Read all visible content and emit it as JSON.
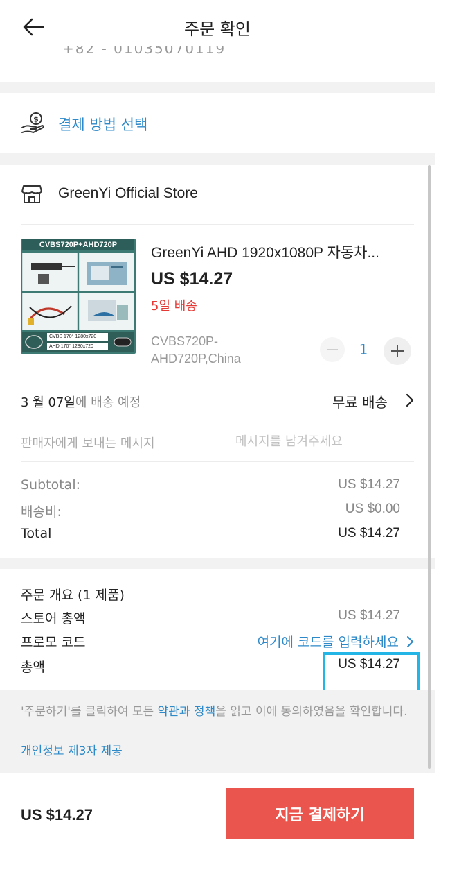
{
  "header": {
    "title": "주문 확인",
    "back_icon": "arrow-left-icon",
    "address_partial": "+82 - 01035070119"
  },
  "payment": {
    "label": "결제 방법 선택",
    "icon": "hand-coin-icon"
  },
  "store": {
    "name": "GreenYi Official Store",
    "icon": "storefront-icon"
  },
  "product": {
    "image_banner": "CVBS720P+AHD720P",
    "image_strip": [
      "CVBS 170° 1280x720",
      "AHD 170° 1280x720"
    ],
    "title": "GreenYi AHD 1920x1080P 자동차...",
    "price": "US $14.27",
    "shipping": "5일 배송",
    "variant": "CVBS720P-AHD720P,China",
    "quantity": "1"
  },
  "delivery": {
    "date_strong": "3 월 07일",
    "date_rest": "에 배송 예정",
    "method": "무료 배송"
  },
  "message": {
    "label": "판매자에게 보내는 메시지",
    "placeholder": "메시지를 남겨주세요"
  },
  "costs": {
    "subtotal_label": "Subtotal:",
    "subtotal_value": "US $14.27",
    "shipping_label": "배송비:",
    "shipping_value": "US $0.00",
    "total_label": "Total",
    "total_value": "US $14.27"
  },
  "summary": {
    "heading": "주문 개요 (1 제품)",
    "store_total_label": "스토어 총액",
    "store_total_value": "US $14.27",
    "promo_label": "프로모 코드",
    "promo_link": "여기에 코드를 입력하세요",
    "grand_total_label": "총액",
    "grand_total_value": "US $14.27"
  },
  "terms": {
    "prefix": "'주문하기'를 클릭하여 모든 ",
    "link": "약관과 정책",
    "suffix": "을 읽고 이에 동의하였음을 확인합니다.",
    "privacy_link": "개인정보 제3자 제공"
  },
  "footer": {
    "total": "US $14.27",
    "pay_button": "지금 결제하기"
  },
  "colors": {
    "accent_blue": "#2d89c8",
    "pay_red": "#ea564d",
    "shipping_red": "#e53935",
    "highlight": "#22b5e6"
  }
}
